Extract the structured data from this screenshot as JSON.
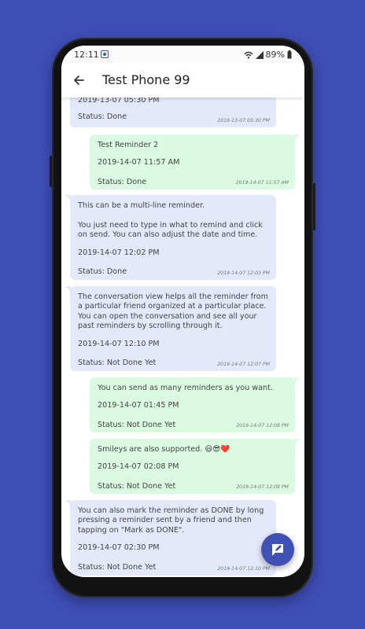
{
  "statusbar": {
    "time": "12:11",
    "battery": "89%"
  },
  "appbar": {
    "title": "Test Phone 99"
  },
  "messages": [
    {
      "date": "2019-13-07  05:30 PM",
      "status": "Status:  Done",
      "time": "2019-13-07 05:30 PM"
    },
    {
      "text": "Test Reminder 2",
      "date": "2019-14-07  11:57 AM",
      "status": "Status:  Done",
      "time": "2019-14-07 11:57 AM"
    },
    {
      "text": "This can be a multi-line reminder.\n\nYou just need to type in what to remind and click on send. You can also adjust the date and time.",
      "date": "2019-14-07  12:02 PM",
      "status": "Status:  Done",
      "time": "2019-14-07 12:03 PM"
    },
    {
      "text": "The conversation view helps all the reminder from a particular friend organized at a particular place. You can open the conversation and see all your past reminders by scrolling through it.",
      "date": "2019-14-07  12:10 PM",
      "status": "Status:  Not Done Yet",
      "time": "2019-14-07 12:07 PM"
    },
    {
      "text": "You can send as many reminders as you want.",
      "date": "2019-14-07  01:45 PM",
      "status": "Status:  Not Done Yet",
      "time": "2019-14-07 12:08 PM"
    },
    {
      "text": "Smileys are also supported. 😃😎❤️",
      "date": "2019-14-07  02:08 PM",
      "status": "Status:  Not Done Yet",
      "time": "2019-14-07 12:09 PM"
    },
    {
      "text": "You can also mark the reminder as DONE by long pressing a reminder sent by a friend and then tapping on \"Mark as DONE\".",
      "date": "2019-14-07  02:30 PM",
      "status": "Status:  Not Done Yet",
      "time": "2019-14-07 12:10 PM"
    }
  ],
  "icons": {
    "back": "arrow-back-icon",
    "fab": "compose-icon",
    "accent": "#3f51b5"
  }
}
